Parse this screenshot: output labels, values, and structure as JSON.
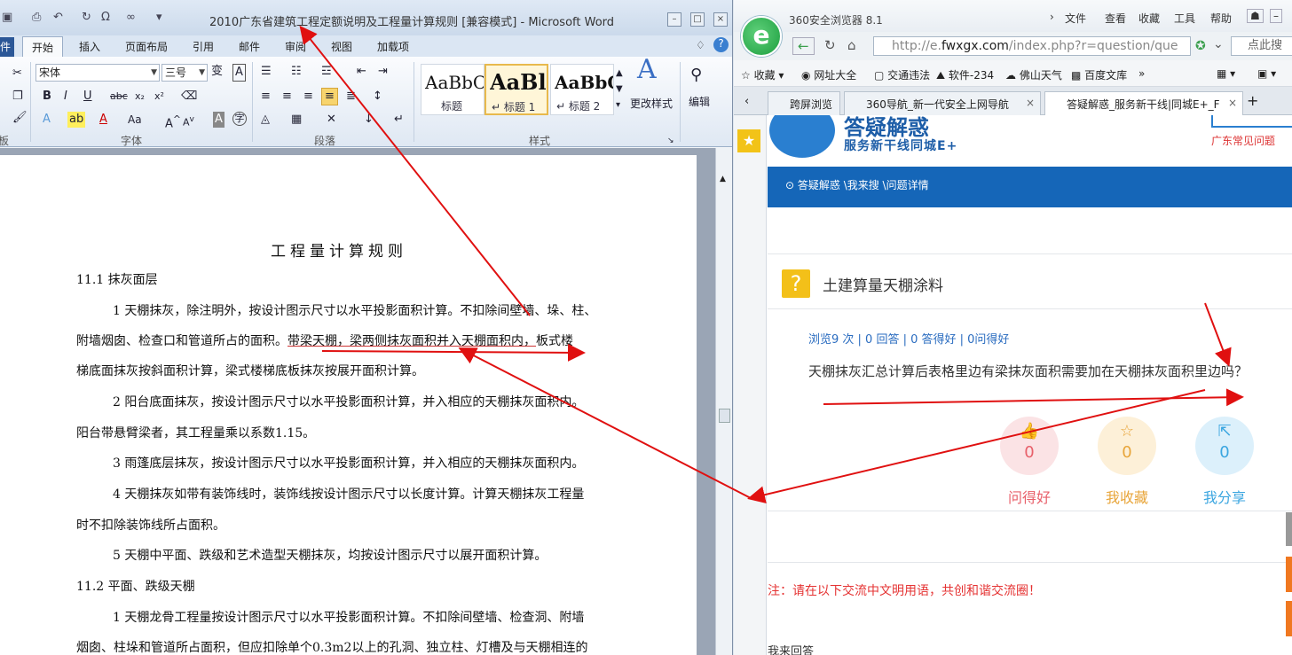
{
  "word": {
    "title": "2010广东省建筑工程定额说明及工程量计算规则 [兼容模式] - Microsoft Word",
    "file_tab": "件",
    "tabs": [
      "开始",
      "插入",
      "页面布局",
      "引用",
      "邮件",
      "审阅",
      "视图",
      "加载项"
    ],
    "active_tab": "开始",
    "font_name": "宋体",
    "font_size": "三号",
    "groups": {
      "clipboard": "板",
      "font": "字体",
      "paragraph": "段落",
      "styles": "样式"
    },
    "styles": [
      {
        "preview": "AaBbC",
        "name": "标题"
      },
      {
        "preview": "AaBl",
        "name": "↵ 标题 1"
      },
      {
        "preview": "AaBbC",
        "name": "↵ 标题 2"
      }
    ],
    "change_styles": "更改样式",
    "editing": "编辑",
    "document": {
      "heading": "工程量计算规则",
      "lines": [
        "11.1   抹灰面层",
        "1 天棚抹灰，除注明外，按设计图示尺寸以水平投影面积计算。不扣除间壁墙、垛、柱、",
        "附墙烟囱、检查口和管道所占的面积。",
        "带梁天棚，梁两侧抹灰面积并入天棚面积内，",
        "板式楼",
        "梯底面抹灰按斜面积计算，梁式楼梯底板抹灰按展开面积计算。",
        "2 阳台底面抹灰，按设计图示尺寸以水平投影面积计算，并入相应的天棚抹灰面积内。",
        "阳台带悬臂梁者，其工程量乘以系数1.15。",
        "3 雨篷底层抹灰，按设计图示尺寸以水平投影面积计算，并入相应的天棚抹灰面积内。",
        "4 天棚抹灰如带有装饰线时，装饰线按设计图示尺寸以长度计算。计算天棚抹灰工程量",
        "时不扣除装饰线所占面积。",
        "5 天棚中平面、跌级和艺术造型天棚抹灰，均按设计图示尺寸以展开面积计算。",
        "11.2  平面、跌级天棚",
        "1 天棚龙骨工程量按设计图示尺寸以水平投影面积计算。不扣除间壁墙、检查洞、附墙",
        "烟囱、柱垛和管道所占面积，但应扣除单个0.3m2以上的孔洞、独立柱、灯槽及与天棚相连的"
      ]
    }
  },
  "browser": {
    "name": "360安全浏览器 8.1",
    "logo_letter": "e",
    "menu": [
      "文件",
      "查看",
      "收藏",
      "工具",
      "帮助"
    ],
    "url_prefix": "http://e.",
    "url_host": "fwxgx.com",
    "url_rest": "/index.php?r=question/que",
    "search_placeholder": "点此搜",
    "favorites": [
      "收藏",
      "网址大全",
      "交通违法",
      "软件-234",
      "佛山天气",
      "百度文库"
    ],
    "tabs": [
      {
        "label": "跨屏浏览"
      },
      {
        "label": "360导航_新一代安全上网导航"
      },
      {
        "label": "答疑解惑_服务新干线|同城E+_F"
      }
    ],
    "site": {
      "title": "答疑解惑",
      "subtitle": "服务新干线同城E+",
      "right_link": "广东常见问题",
      "breadcrumb": "答疑解惑 \\我来搜 \\问题详情",
      "question_title": "土建算量天棚涂料",
      "stats": "浏览9 次 | 0 回答 | 0 答得好 | 0问得好",
      "question_body": "天棚抹灰汇总计算后表格里边有梁抹灰面积需要加在天棚抹灰面积里边吗？",
      "actions": [
        {
          "count": "0",
          "label": "问得好",
          "color": "#e8606a",
          "bg": "#fbe3e5"
        },
        {
          "count": "0",
          "label": "我收藏",
          "color": "#e8a53a",
          "bg": "#fdf0d8"
        },
        {
          "count": "0",
          "label": "我分享",
          "color": "#3ba6e0",
          "bg": "#dcf0fb"
        }
      ],
      "notice": "注：请在以下交流中文明用语，共创和谐交流圈！",
      "reply_heading": "我来回答"
    }
  },
  "colors": {
    "arrow": "#e01010",
    "brand_blue": "#1566b8",
    "accent_red": "#e53333"
  }
}
